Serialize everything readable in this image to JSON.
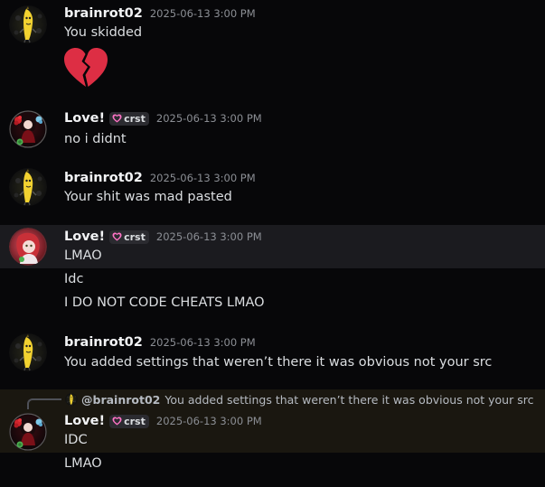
{
  "messages": [
    {
      "author": "brainrot02",
      "timestamp": "2025-06-13 3:00 PM",
      "lines": [
        "You skidded"
      ],
      "emoji": "broken-heart"
    },
    {
      "author": "Love!",
      "tag": "crst",
      "timestamp": "2025-06-13 3:00 PM",
      "lines": [
        "no i didnt"
      ]
    },
    {
      "author": "brainrot02",
      "timestamp": "2025-06-13 3:00 PM",
      "lines": [
        "Your shit was mad pasted"
      ]
    },
    {
      "author": "Love!",
      "tag": "crst",
      "timestamp": "2025-06-13 3:00 PM",
      "lines": [
        "LMAO",
        "Idc",
        "I DO NOT CODE CHEATS LMAO"
      ]
    },
    {
      "author": "brainrot02",
      "timestamp": "2025-06-13 3:00 PM",
      "lines": [
        "You added settings that weren’t there it was obvious not your src"
      ]
    },
    {
      "reply": {
        "mention": "@brainrot02",
        "text": "You added settings that weren’t there it was obvious not your src"
      },
      "author": "Love!",
      "tag": "crst",
      "timestamp": "2025-06-13 3:00 PM",
      "lines": [
        "IDC",
        "LMAO"
      ]
    }
  ],
  "colors": {
    "background": "#070709",
    "username": "#f2f3f5",
    "text": "#dbdee1",
    "timestamp": "#8b8e94",
    "tag_heart": "#ff73c6",
    "emoji_red": "#dd2e44"
  }
}
